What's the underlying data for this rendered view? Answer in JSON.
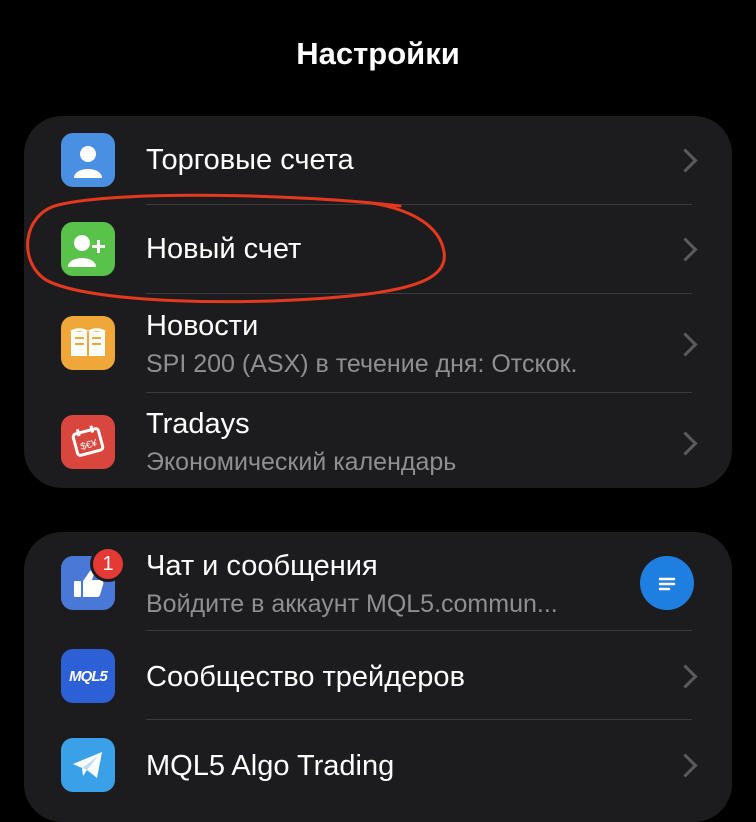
{
  "header": {
    "title": "Настройки"
  },
  "colors": {
    "accounts_icon": "#4a90e2",
    "new_account_icon": "#59c24a",
    "news_icon": "#f0a73a",
    "tradays_icon": "#d9463e",
    "chat_icon": "#4a78d6",
    "mql5_icon": "#2d5fd6",
    "telegram_icon": "#3aa0e8",
    "annotation": "#e5391f"
  },
  "group1": {
    "items": [
      {
        "label": "Торговые счета",
        "icon": "person-icon"
      },
      {
        "label": "Новый счет",
        "icon": "add-person-icon"
      },
      {
        "label": "Новости",
        "subtitle": "SPI 200 (ASX) в течение дня: Отскок.",
        "icon": "book-icon"
      },
      {
        "label": "Tradays",
        "subtitle": "Экономический календарь",
        "icon": "calendar-icon"
      }
    ]
  },
  "group2": {
    "items": [
      {
        "label": "Чат и сообщения",
        "subtitle": "Войдите в аккаунт MQL5.commun...",
        "icon": "thumbs-up-icon",
        "badge": "1"
      },
      {
        "label": "Сообщество трейдеров",
        "icon": "mql5-icon",
        "icon_text": "MQL5"
      },
      {
        "label": "MQL5 Algo Trading",
        "icon": "telegram-icon"
      }
    ]
  }
}
